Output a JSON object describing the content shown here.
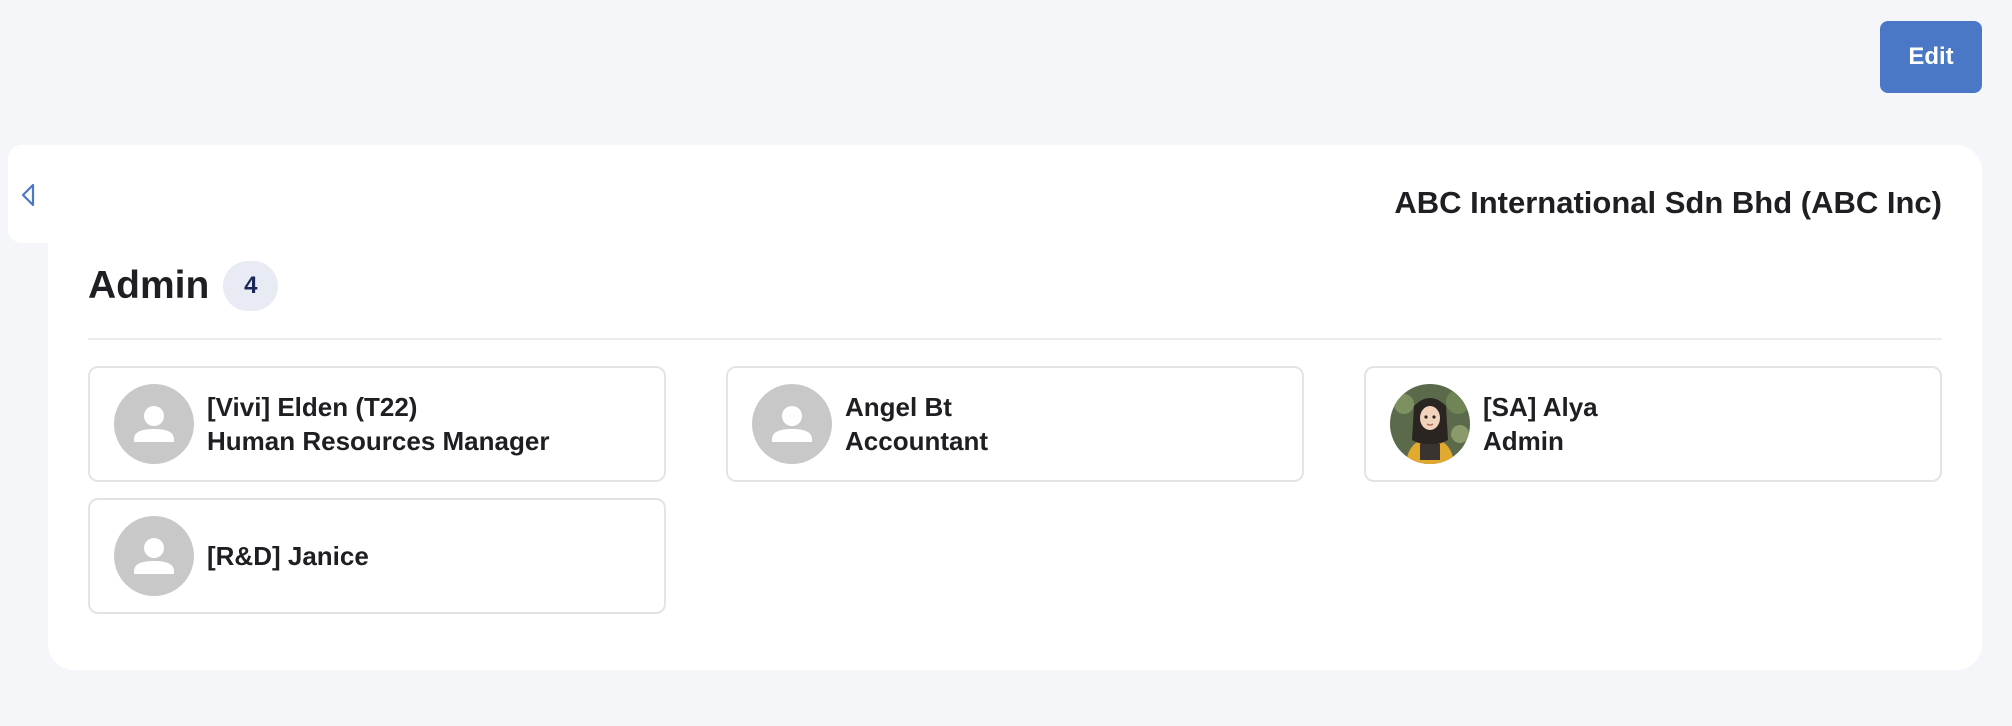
{
  "toolbar": {
    "edit_label": "Edit"
  },
  "organization": {
    "name": "ABC International Sdn Bhd (ABC Inc)"
  },
  "group": {
    "title": "Admin",
    "count": "4"
  },
  "members": [
    {
      "name": "[Vivi] Elden (T22)",
      "role": "Human Resources Manager",
      "avatar": "person-placeholder-icon"
    },
    {
      "name": "Angel Bt",
      "role": "Accountant",
      "avatar": "person-placeholder-icon"
    },
    {
      "name": "[SA] Alya",
      "role": "Admin",
      "avatar": "photo"
    },
    {
      "name": "[R&D] Janice",
      "role": "",
      "avatar": "person-placeholder-icon"
    }
  ],
  "icons": {
    "collapse": "caret-left-icon"
  },
  "colors": {
    "accent": "#4a78c6",
    "background": "#f5f6fa",
    "card": "#ffffff",
    "badge_bg": "#e8eaf4",
    "badge_text": "#1c2757",
    "avatar_placeholder": "#c8c8c8"
  }
}
